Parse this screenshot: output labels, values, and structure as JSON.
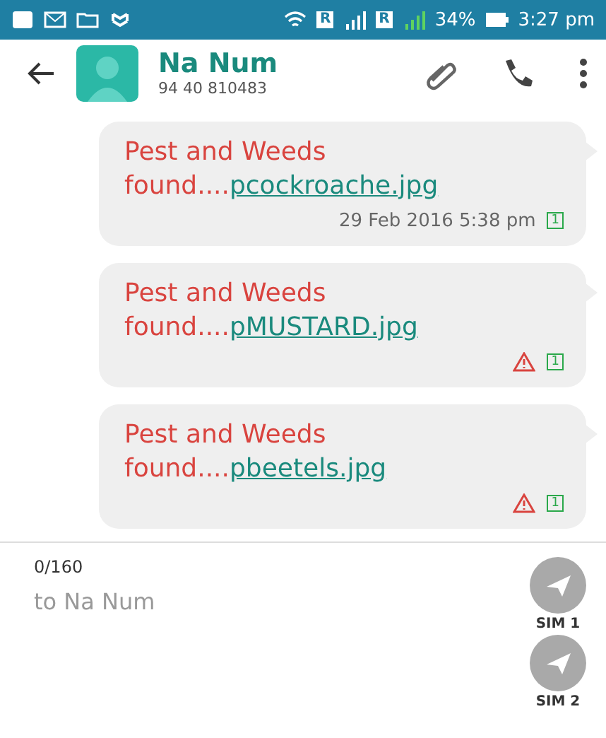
{
  "status_bar": {
    "sim_badges": [
      "R",
      "R"
    ],
    "battery_percent": "34%",
    "time": "3:27 pm"
  },
  "header": {
    "contact_name": "Na Num",
    "contact_number": "94 40 810483"
  },
  "messages": [
    {
      "text": "Pest and Weeds found....",
      "attachment": "pcockroache.jpg",
      "time": "29 Feb 2016 5:38 pm",
      "failed": false,
      "sim": "1"
    },
    {
      "text": "Pest and Weeds found....",
      "attachment": "pMUSTARD.jpg",
      "failed": true,
      "sim": "1"
    },
    {
      "text": "Pest and Weeds found....",
      "attachment": "pbeetels.jpg",
      "failed": true,
      "sim": "1"
    }
  ],
  "composer": {
    "counter": "0/160",
    "placeholder": "to Na Num",
    "send_buttons": [
      {
        "label": "SIM 1"
      },
      {
        "label": "SIM 2"
      }
    ]
  }
}
